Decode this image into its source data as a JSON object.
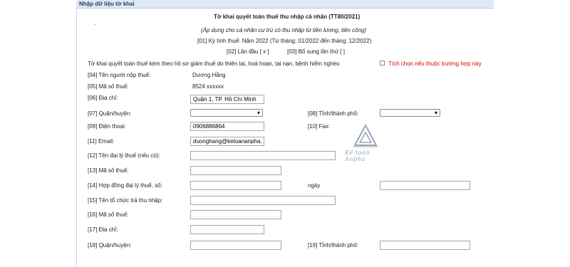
{
  "section_title": "Nhập dữ liệu tờ khai",
  "form": {
    "title": "Tờ khai quyết toán thuế thu nhập cá nhân (TT80/2021)",
    "subtitle": "(Áp dụng cho cá nhân cư trú có thu nhập từ tiền lương, tiền công)",
    "period": "[01] Kỳ tính thuế:   Năm 2022 (Từ tháng: 01/2022 đến tháng: 12/2022)",
    "first_time": "[02] Lần đầu [ x ]",
    "supplement": "[03] Bổ sung lần thứ   [ ]",
    "disaster_note": "Tờ khai quyết toán thuế kèm theo hồ sơ giảm thuế do thiên tai, hoả hoạn, tai nạn, bệnh hiểm nghèo",
    "disaster_checkbox_label": "Tích chọn nếu thuộc trường hợp này"
  },
  "fields": {
    "f04_label": "[04] Tên người nộp thuế:",
    "f04_value": "Dương Hằng",
    "f05_label": "[05] Mã số thuế:",
    "f05_value": "8524 xxxxxx",
    "f06_label": "[06] Địa chỉ:",
    "f06_value": "Quận 1, TP. Hồ Chí Minh",
    "f07_label": "[07] Quận/huyện:",
    "f08_label": "[08] Tỉnh/thành phố:",
    "f09_label": "[09] Điện thoại:",
    "f09_value": "0906886864",
    "f10_label": "[10] Fax:",
    "f11_label": "[11] Email:",
    "f11_value": "duonghang@ketoananpha.",
    "f12_label": "[12] Tên đại lý thuế (nếu có):",
    "f13_label": "[13] Mã số thuế:",
    "f14_label": "[14] Hợp đồng đại lý thuế, số:",
    "f14_date_label": "ngày",
    "f15_label": "[15] Tên tổ chức trả thu nhập:",
    "f16_label": "[16] Mã số thuế:",
    "f17_label": "[17] Địa chỉ:",
    "f18_label": "[18] Quận/huyện:",
    "f19_label": "[19] Tỉnh/thành phố:"
  },
  "dropdowns": {
    "chevron": "▾"
  },
  "watermark": {
    "logo_text": "Kế toán Anpha",
    "color": "#9aa3b8"
  },
  "colors": {
    "header_bg": "#dfe9f5",
    "header_text": "#23426b",
    "required_note": "#d40000"
  }
}
